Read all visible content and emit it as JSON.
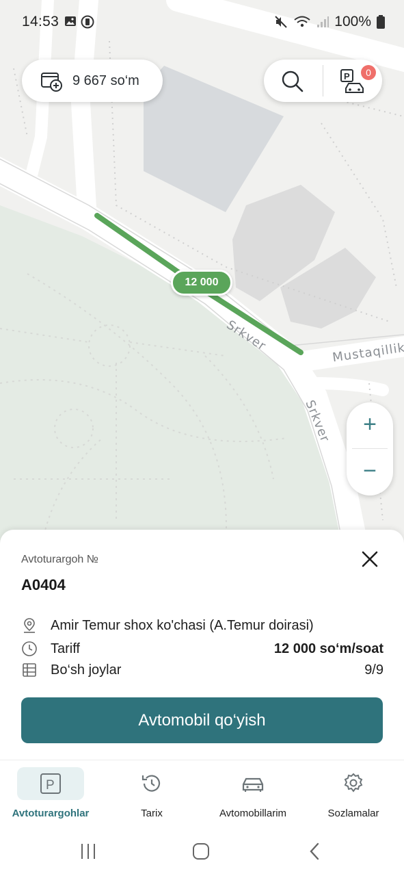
{
  "status_bar": {
    "time": "14:53",
    "battery": "100%"
  },
  "header": {
    "balance": "9 667 so‘m",
    "parking_badge_count": "0"
  },
  "map": {
    "price_chip": "12 000",
    "street_labels": [
      "Srkver",
      "Mustaqillik",
      "Srkver"
    ]
  },
  "sheet": {
    "label": "Avtoturargoh №",
    "code": "A0404",
    "address": "Amir Temur shox ko'chasi (A.Temur doirasi)",
    "tariff_label": "Tariff",
    "tariff_value": "12 000 so‘m/soat",
    "free_label": "Bo‘sh joylar",
    "free_value": "9/9",
    "cta": "Avtomobil qo‘yish"
  },
  "nav": {
    "items": [
      {
        "label": "Avtoturargohlar",
        "icon": "parking-icon",
        "active": true
      },
      {
        "label": "Tarix",
        "icon": "history-icon"
      },
      {
        "label": "Avtomobillarim",
        "icon": "car-icon"
      },
      {
        "label": "Sozlamalar",
        "icon": "gear-icon"
      }
    ]
  },
  "colors": {
    "accent": "#2f737c",
    "route": "#5aa55a",
    "badge": "#ef6f6a"
  }
}
